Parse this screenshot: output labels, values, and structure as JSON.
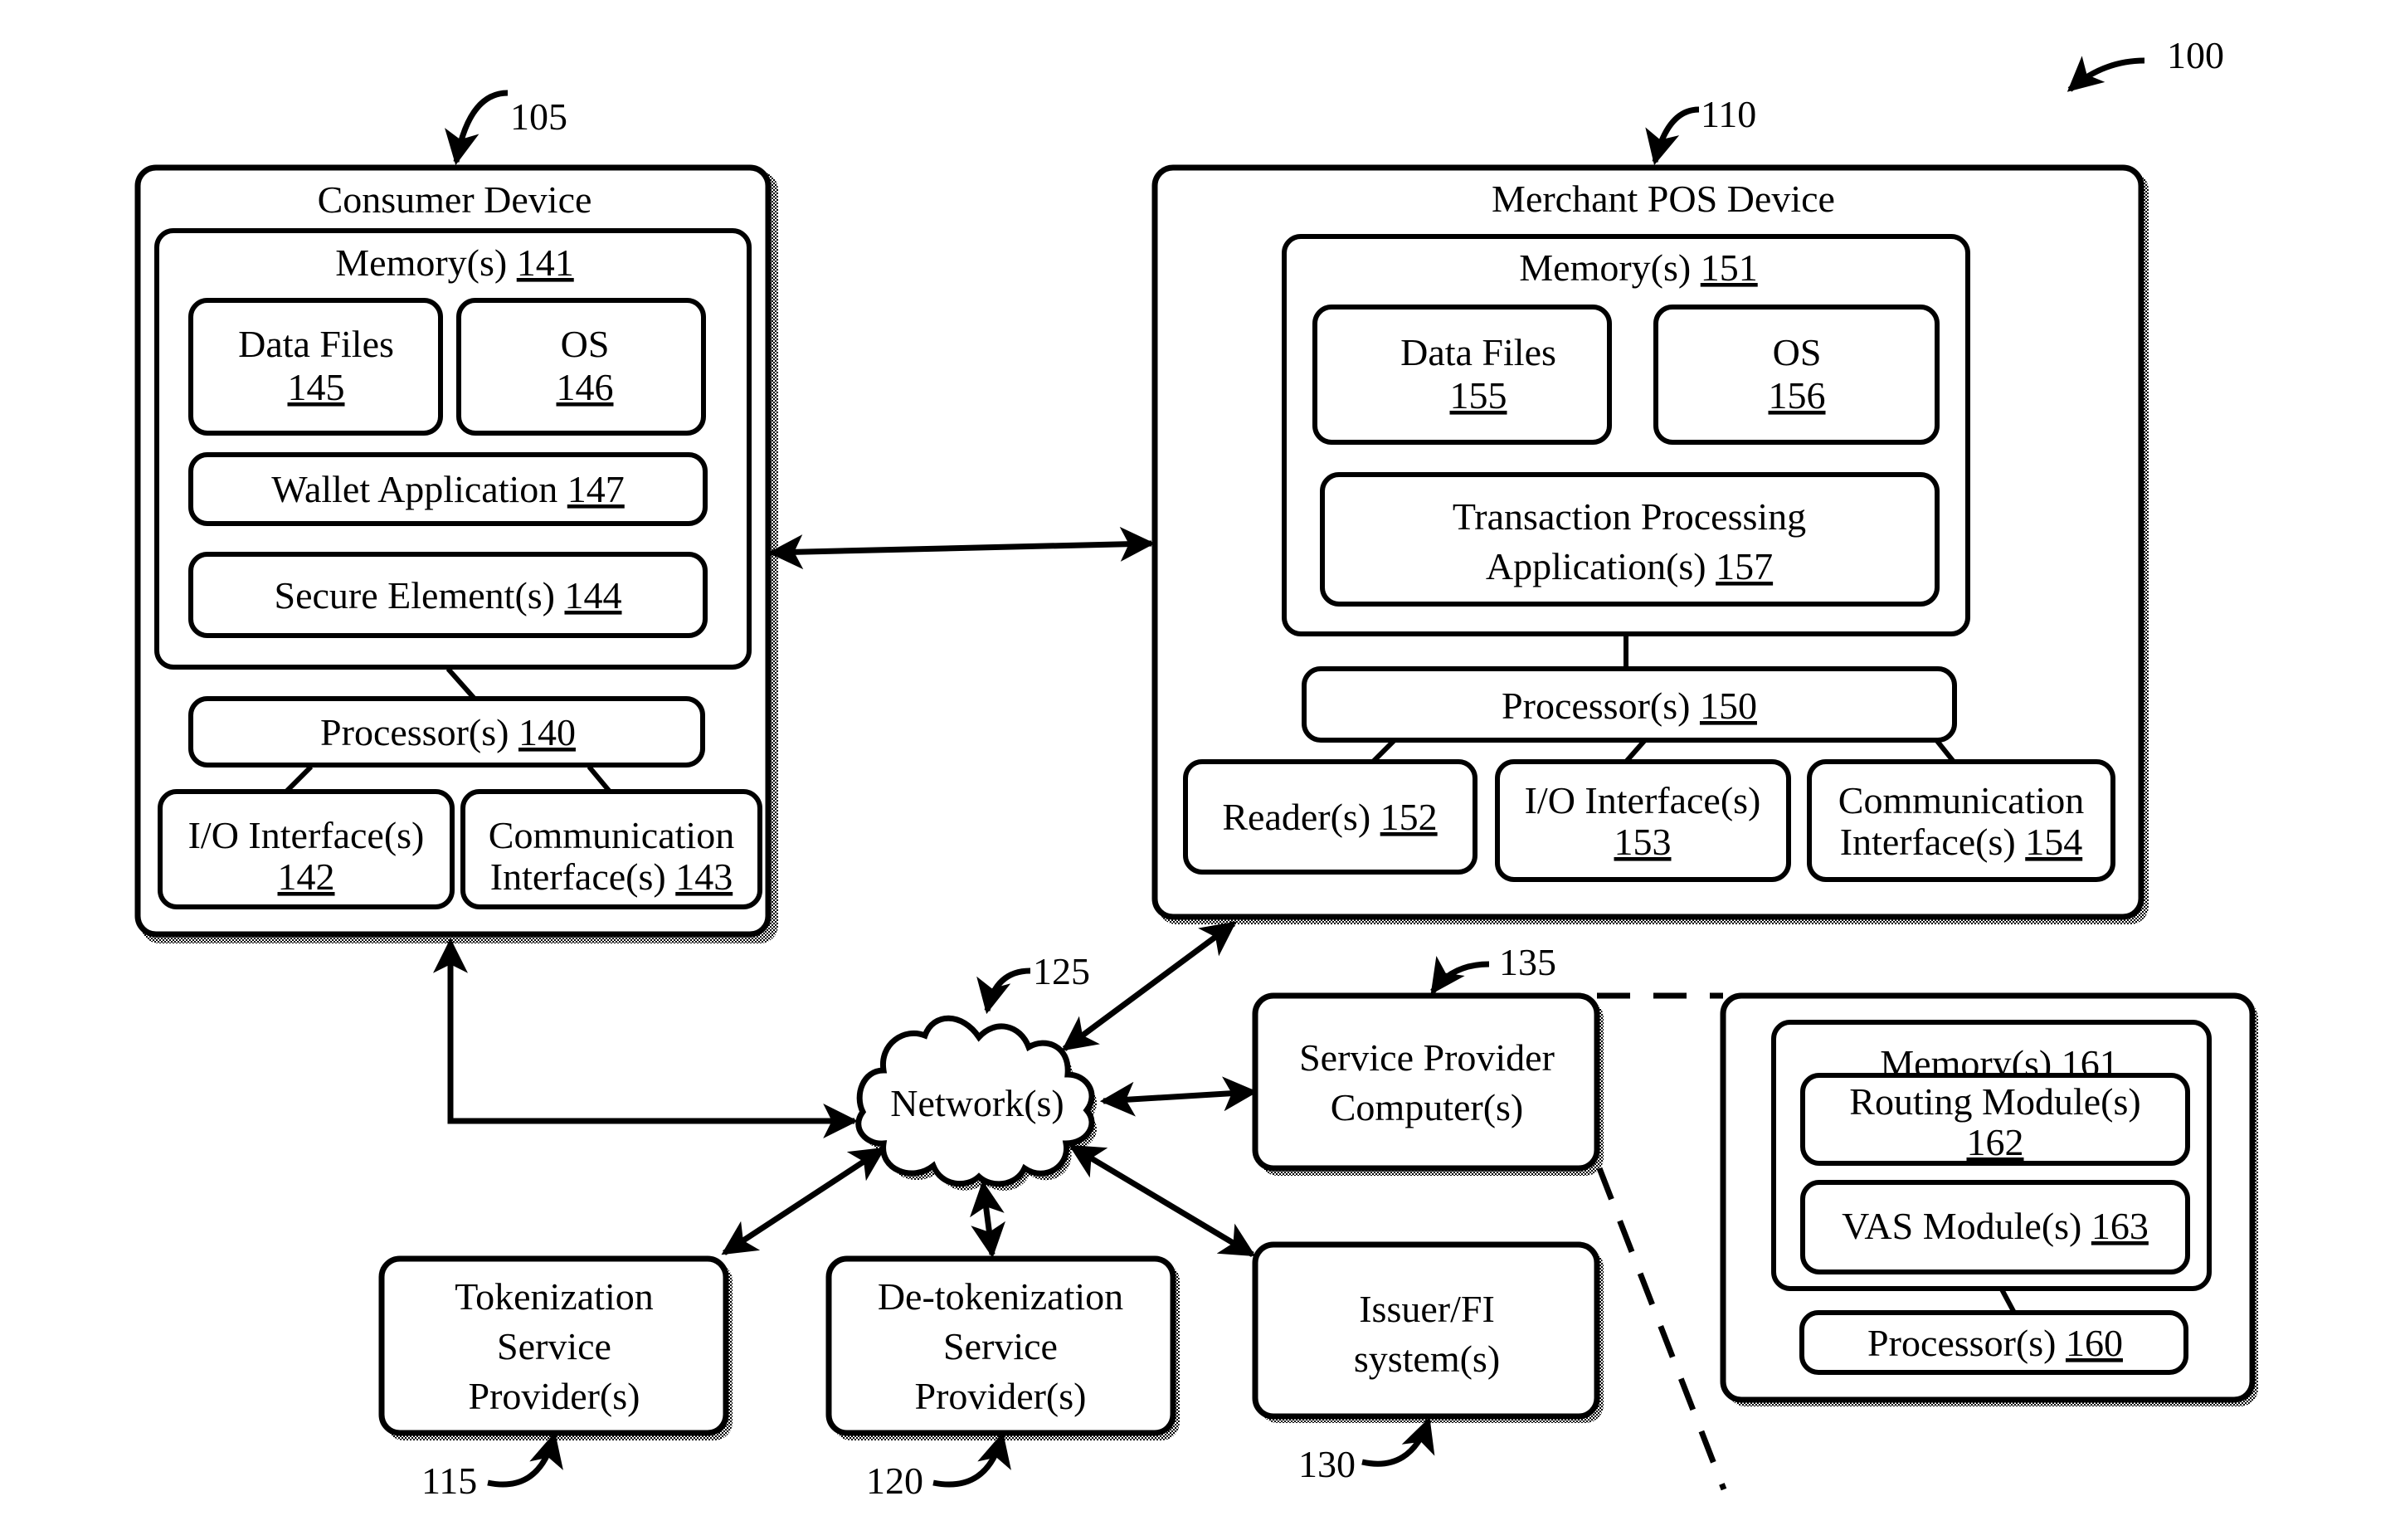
{
  "figure": {
    "ref": "100",
    "background": "#ffffff",
    "ink": "#000000"
  },
  "consumer_device": {
    "ref": "105",
    "title": "Consumer Device",
    "memory": {
      "label": "Memory(s)",
      "num": "141"
    },
    "data_files": {
      "label": "Data Files",
      "num": "145"
    },
    "os": {
      "label": "OS",
      "num": "146"
    },
    "wallet": {
      "label": "Wallet Application",
      "num": "147"
    },
    "secure_element": {
      "label": "Secure Element(s)",
      "num": "144"
    },
    "processor": {
      "label": "Processor(s)",
      "num": "140"
    },
    "io": {
      "label": "I/O Interface(s)",
      "num": "142"
    },
    "comm": {
      "label1": "Communication",
      "label2": "Interface(s)",
      "num": "143"
    }
  },
  "merchant_pos": {
    "ref": "110",
    "title": "Merchant POS Device",
    "memory": {
      "label": "Memory(s)",
      "num": "151"
    },
    "data_files": {
      "label": "Data Files",
      "num": "155"
    },
    "os": {
      "label": "OS",
      "num": "156"
    },
    "transaction_app": {
      "label1": "Transaction Processing",
      "label2": "Application(s)",
      "num": "157"
    },
    "processor": {
      "label": "Processor(s)",
      "num": "150"
    },
    "reader": {
      "label": "Reader(s)",
      "num": "152"
    },
    "io": {
      "label": "I/O Interface(s)",
      "num": "153"
    },
    "comm": {
      "label1": "Communication",
      "label2": "Interface(s)",
      "num": "154"
    }
  },
  "network": {
    "ref": "125",
    "label": "Network(s)"
  },
  "service_provider": {
    "ref": "135",
    "label1": "Service Provider",
    "label2": "Computer(s)",
    "detail": {
      "memory": {
        "label": "Memory(s)",
        "num": "161"
      },
      "routing": {
        "label": "Routing Module(s)",
        "num": "162"
      },
      "vas": {
        "label": "VAS Module(s)",
        "num": "163"
      },
      "processor": {
        "label": "Processor(s)",
        "num": "160"
      }
    }
  },
  "tokenization": {
    "ref": "115",
    "line1": "Tokenization",
    "line2": "Service",
    "line3": "Provider(s)"
  },
  "detokenization": {
    "ref": "120",
    "line1": "De-tokenization",
    "line2": "Service",
    "line3": "Provider(s)"
  },
  "issuer": {
    "ref": "130",
    "line1": "Issuer/FI",
    "line2": "system(s)"
  }
}
